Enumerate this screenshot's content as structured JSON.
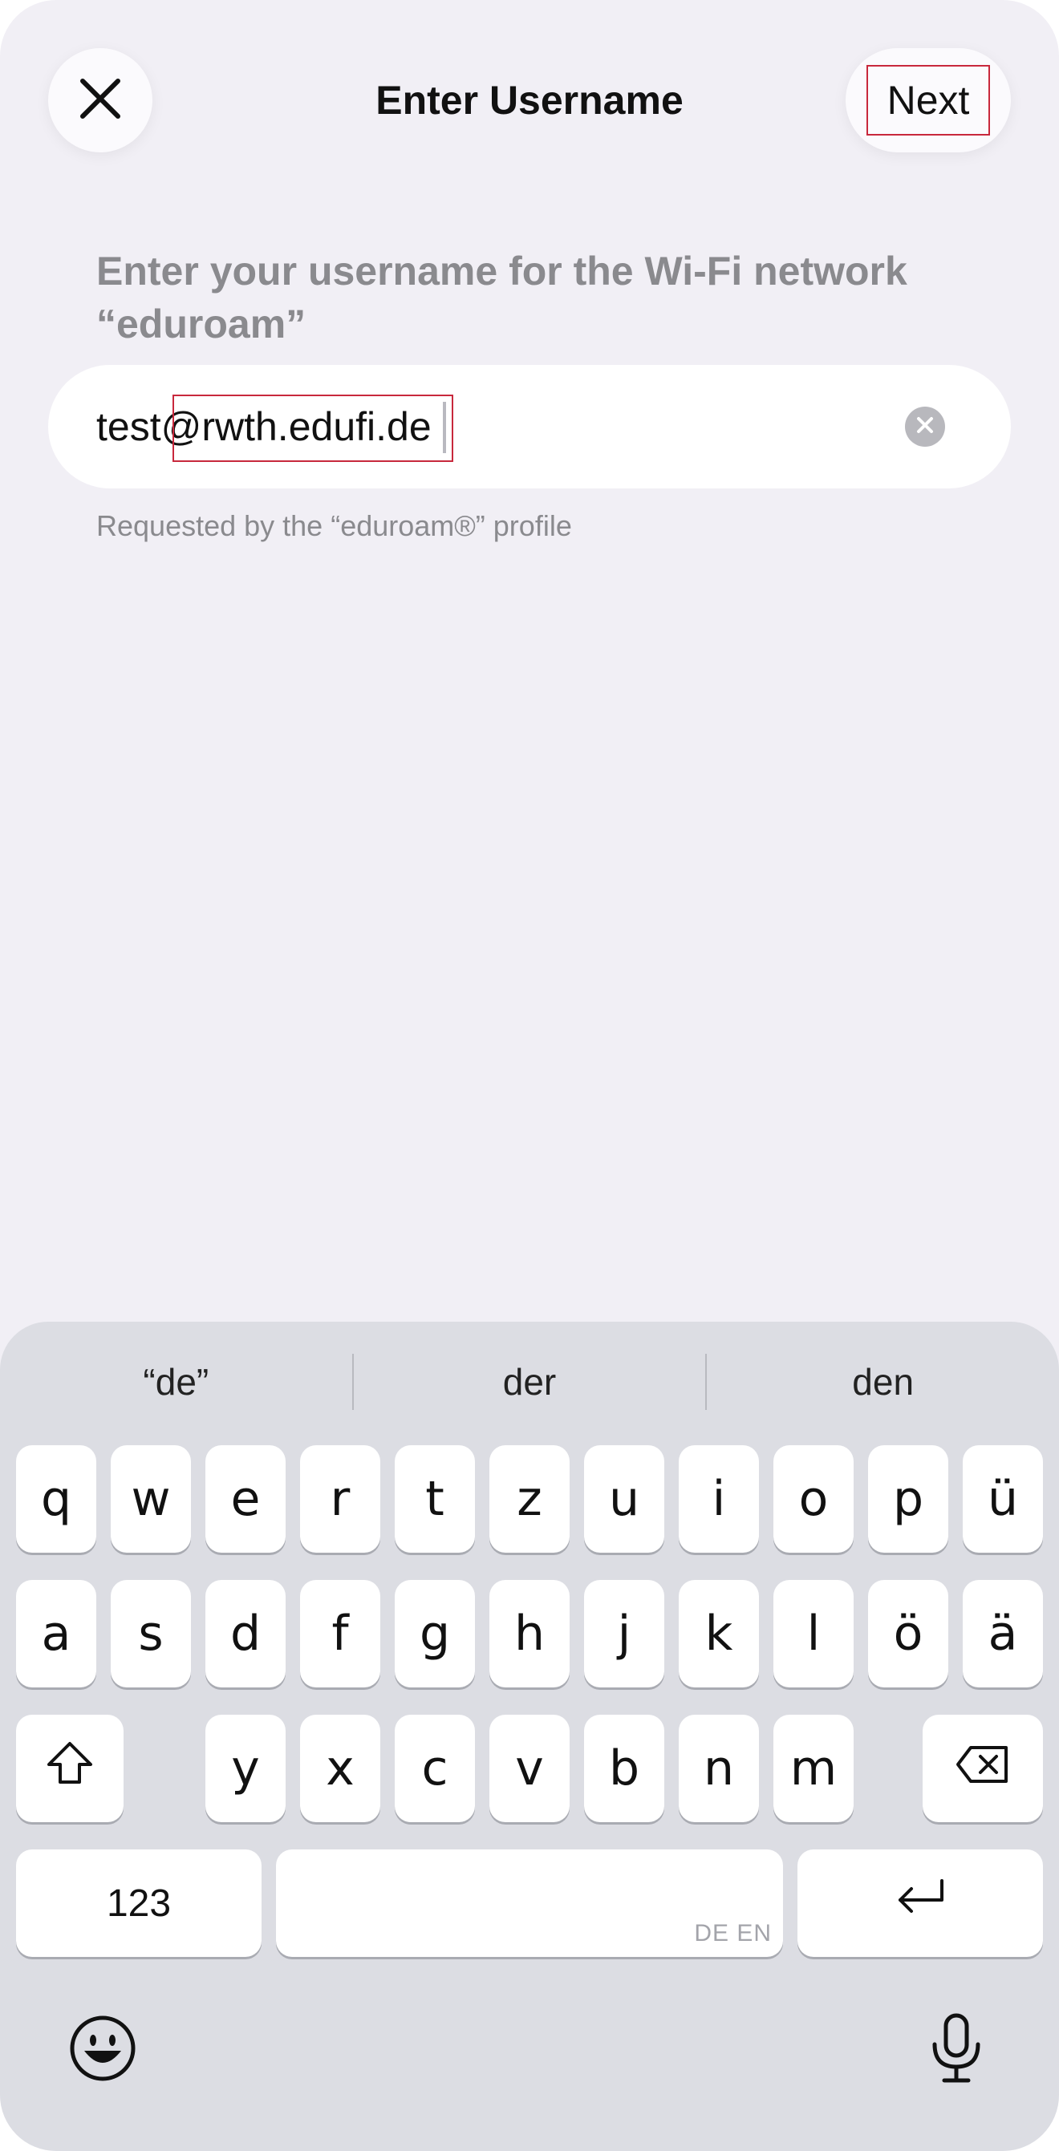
{
  "header": {
    "title": "Enter Username",
    "next_label": "Next",
    "close_icon": "close-icon"
  },
  "main": {
    "prompt": "Enter your username for the Wi-Fi network “eduroam”",
    "username_value": "test@rwth.edufi.de",
    "hint": "Requested by the “eduroam®” profile",
    "clear_icon": "clear-x-icon"
  },
  "keyboard": {
    "suggestions": [
      "“de”",
      "der",
      "den"
    ],
    "row1": [
      "q",
      "w",
      "e",
      "r",
      "t",
      "z",
      "u",
      "i",
      "o",
      "p",
      "ü"
    ],
    "row2": [
      "a",
      "s",
      "d",
      "f",
      "g",
      "h",
      "j",
      "k",
      "l",
      "ö",
      "ä"
    ],
    "row3": [
      "y",
      "x",
      "c",
      "v",
      "b",
      "n",
      "m"
    ],
    "numbers_label": "123",
    "space_lang": "DE EN",
    "icons": [
      "shift-icon",
      "delete-icon",
      "return-icon",
      "emoji-icon",
      "microphone-icon"
    ]
  }
}
